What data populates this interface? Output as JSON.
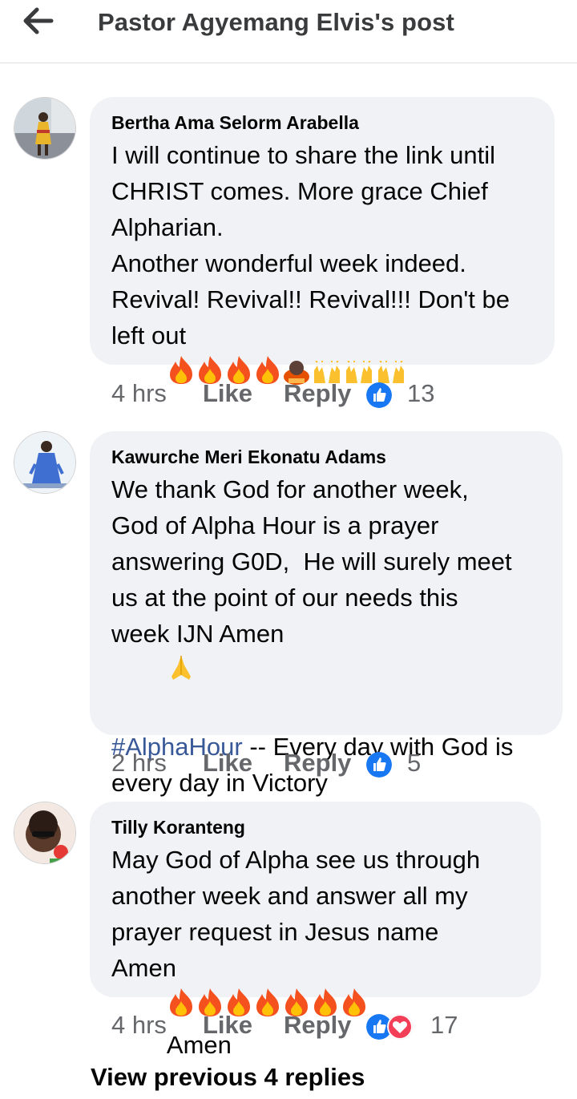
{
  "header": {
    "title": "Pastor Agyemang Elvis's post",
    "back_icon": "arrow-left-icon"
  },
  "comments": [
    {
      "author": "Bertha Ama Selorm Arabella",
      "lines": [
        "I will continue to share the link until",
        "CHRIST comes. More grace Chief",
        "Alpharian.",
        "Another wonderful week indeed.",
        "Revival! Revival!! Revival!!! Don't be"
      ],
      "last_line_text": "left out",
      "time": "4 hrs",
      "like": "Like",
      "reply": "Reply",
      "reaction_count": "13"
    },
    {
      "author": "Kawurche Meri Ekonatu Adams",
      "lines": [
        "We thank God for another week,",
        "God of Alpha Hour is a prayer",
        "answering G0D,  He will surely meet",
        "us at the point of our needs this"
      ],
      "line5_text": "week IJN Amen",
      "hashtag": "#AlphaHour",
      "hashtag_rest": " -- Every day with God is",
      "last_line_text": "every day in Victory",
      "time": "2 hrs",
      "like": "Like",
      "reply": "Reply",
      "reaction_count": "5"
    },
    {
      "author": "Tilly Koranteng",
      "lines": [
        "May God of Alpha see us through",
        "another week and answer all my",
        "prayer request in Jesus name"
      ],
      "last_line_text": "Amen",
      "last_line_suffix": "Amen",
      "time": "4 hrs",
      "like": "Like",
      "reply": "Reply",
      "reaction_count": "17"
    }
  ],
  "more_replies": "View previous 4 replies"
}
